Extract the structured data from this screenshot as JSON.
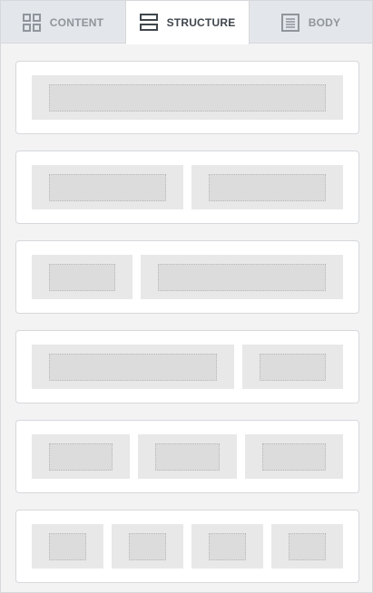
{
  "tabs": [
    {
      "label": "CONTENT",
      "icon": "grid-icon",
      "active": false
    },
    {
      "label": "STRUCTURE",
      "icon": "structure-icon",
      "active": true
    },
    {
      "label": "BODY",
      "icon": "body-icon",
      "active": false
    }
  ],
  "structure_rows": [
    {
      "columns": 1,
      "ratios": [
        1
      ]
    },
    {
      "columns": 2,
      "ratios": [
        1,
        1
      ]
    },
    {
      "columns": 2,
      "ratios": [
        1,
        2
      ]
    },
    {
      "columns": 2,
      "ratios": [
        2,
        1
      ]
    },
    {
      "columns": 3,
      "ratios": [
        1,
        1,
        1
      ]
    },
    {
      "columns": 4,
      "ratios": [
        1,
        1,
        1,
        1
      ]
    }
  ],
  "colors": {
    "active_tab_text": "#3f464d",
    "inactive_tab_text": "#8f959c",
    "tab_bar_bg": "#e3e6ea",
    "column_fill": "#e8e8e9",
    "placeholder_fill": "#dcdcdd"
  }
}
